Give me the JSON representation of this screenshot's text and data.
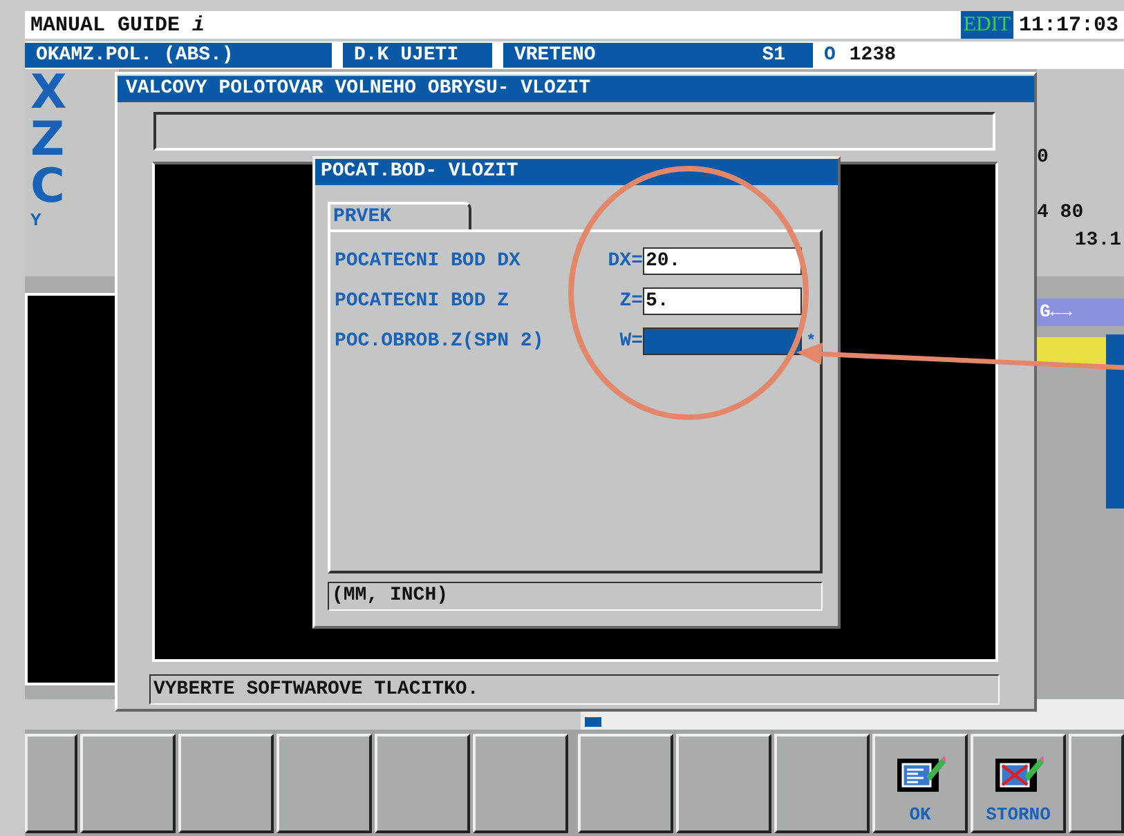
{
  "header": {
    "title": "MANUAL GUIDE",
    "title_suffix": "i",
    "mode": "EDIT",
    "time": "11:17:03"
  },
  "info_bar": [
    {
      "label": "OKAMZ.POL. (ABS.)"
    },
    {
      "label": "D.K UJETI"
    },
    {
      "label": "VRETENO",
      "value": "S1"
    }
  ],
  "program": {
    "letter": "O",
    "number": "1238"
  },
  "axes": [
    {
      "name": "X",
      "kind": "large"
    },
    {
      "name": "Z",
      "kind": "large"
    },
    {
      "name": "C",
      "kind": "large"
    },
    {
      "name": "Y",
      "kind": "small"
    }
  ],
  "side_readings": [
    "0",
    "4 80",
    "13.1"
  ],
  "side_label": "G←→",
  "dialog": {
    "title": "VALCOVY POLOTOVAR VOLNEHO OBRYSU- VLOZIT",
    "message": "VYBERTE SOFTWAROVE TLACITKO."
  },
  "subdialog": {
    "title": "POCAT.BOD- VLOZIT",
    "tabs": [
      {
        "label": "PRVEK",
        "selected": true
      }
    ],
    "fields": [
      {
        "label": "POCATECNI BOD DX",
        "prefix": "DX=",
        "value": "20.",
        "focused": false
      },
      {
        "label": "POCATECNI BOD Z",
        "prefix": "Z=",
        "value": "5.",
        "focused": false
      },
      {
        "label": "POC.OBROB.Z(SPN 2)",
        "prefix": "W=",
        "focused": true,
        "marker": "*"
      }
    ],
    "hint": "(MM, INCH)"
  },
  "softkeys": [
    {
      "kind": "blank"
    },
    {
      "kind": "blank"
    },
    {
      "kind": "blank"
    },
    {
      "kind": "blank"
    },
    {
      "kind": "blank"
    },
    {
      "kind": "blank"
    },
    {
      "kind": "blank"
    },
    {
      "kind": "blank"
    },
    {
      "kind": "blank"
    },
    {
      "kind": "ok",
      "label": "OK"
    },
    {
      "kind": "cancel",
      "label": "STORNO"
    },
    {
      "kind": "blank"
    }
  ]
}
